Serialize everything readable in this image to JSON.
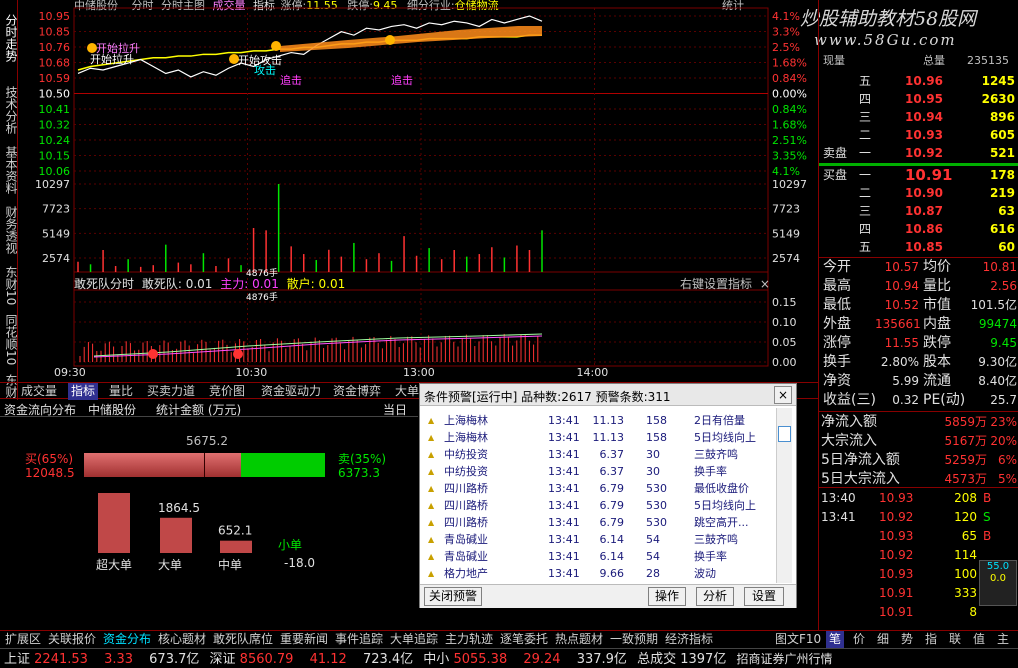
{
  "header": {
    "stock": "中储股份",
    "t1": "分时",
    "t2": "分时主图",
    "t3": "成交量",
    "t4": "指标",
    "zt_label": "涨停:",
    "zt_val": "11.55",
    "dt_label": "跌停:",
    "dt_val": "9.45",
    "industry_label": "细分行业:",
    "industry": "仓储物流",
    "stat": "统计"
  },
  "left_tabs": [
    "分时走势",
    "技术分析",
    "基本资料",
    "财务透视",
    "东财10",
    "同花顺10",
    "东财"
  ],
  "price_axis_left": [
    "10.95",
    "10.85",
    "10.76",
    "10.68",
    "10.59",
    "10.50",
    "10.41",
    "10.32",
    "10.24",
    "10.15",
    "10.06"
  ],
  "pct_axis_right": [
    "4.1%",
    "3.3%",
    "2.5%",
    "1.68%",
    "0.84%",
    "0.00%",
    "0.84%",
    "1.68%",
    "2.51%",
    "3.35%",
    "4.1%"
  ],
  "vol_axis_left": [
    "10297",
    "7723",
    "5149",
    "2574"
  ],
  "vol_axis_right": [
    "10297",
    "7723",
    "5149",
    "2574"
  ],
  "ind_axis_right": [
    "0.15",
    "0.10",
    "0.05",
    "0.00"
  ],
  "time_axis": [
    "09:30",
    "10:30",
    "13:00",
    "14:00"
  ],
  "indicator_line": {
    "name": "敢死队分时",
    "p1": "敢死队: 0.01",
    "p2": "主力: 0.01",
    "p3": "散户: 0.01",
    "right": "右键设置指标",
    "close": "×"
  },
  "signals": {
    "s1": "开始拉升",
    "s2": "开始拉升",
    "s3": "开始攻击",
    "s4": "攻击",
    "s5": "追击",
    "s6": "追击",
    "vol_mark1": "4876手",
    "vol_mark2": "4876手"
  },
  "watermark": {
    "line1": "炒股辅助教材58股网",
    "line2": "www.58Gu.com"
  },
  "chart_data": {
    "type": "line",
    "title": "中储股份 分时",
    "x": [
      "09:30",
      "10:30",
      "13:00",
      "14:00"
    ],
    "ylim": [
      10.06,
      10.95
    ],
    "prev_close": 10.5,
    "series": [
      {
        "name": "价格",
        "values": [
          10.62,
          10.65,
          10.64,
          10.66,
          10.68,
          10.7,
          10.66,
          10.62,
          10.64,
          10.6,
          10.63,
          10.61,
          10.65,
          10.68,
          10.66,
          10.7,
          10.72,
          10.74,
          10.73,
          10.78,
          10.82,
          10.86,
          10.84,
          10.88,
          10.87,
          10.89,
          10.9,
          10.88,
          10.91,
          10.9,
          10.92,
          10.91,
          10.89,
          10.93,
          10.91,
          10.93,
          10.95,
          10.92
        ]
      },
      {
        "name": "均价",
        "values": [
          10.64,
          10.66,
          10.67,
          10.68,
          10.69,
          10.7,
          10.71,
          10.71,
          10.72,
          10.72,
          10.73,
          10.73,
          10.74,
          10.74,
          10.75,
          10.75,
          10.76,
          10.76,
          10.77,
          10.77,
          10.78,
          10.79,
          10.79,
          10.8,
          10.8,
          10.81,
          10.81,
          10.81,
          10.82,
          10.82,
          10.82,
          10.82,
          10.83,
          10.83,
          10.83,
          10.83,
          10.84,
          10.84
        ]
      }
    ],
    "volume": [
      1200,
      900,
      2574,
      700,
      1500,
      600,
      800,
      3200,
      1100,
      900,
      2200,
      700,
      1600,
      800,
      5149,
      4876,
      10297,
      3000,
      2100,
      1400,
      2600,
      1800,
      3400,
      1500,
      2200,
      1300,
      4200,
      1900,
      2800,
      1500,
      2574,
      1800,
      2100,
      2900,
      1700,
      3100,
      2574,
      4876
    ]
  },
  "right_panel": {
    "top_row": {
      "l": "现量",
      "r1": "总量",
      "r2": "235135"
    },
    "sells": [
      {
        "lvl": "五",
        "p": "10.96",
        "v": "1245"
      },
      {
        "lvl": "四",
        "p": "10.95",
        "v": "2630"
      },
      {
        "lvl": "三",
        "p": "10.94",
        "v": "896"
      },
      {
        "lvl": "二",
        "p": "10.93",
        "v": "605"
      },
      {
        "lvl": "一",
        "p": "10.92",
        "v": "521"
      }
    ],
    "sell_label": "卖盘",
    "buy_label": "买盘",
    "buys": [
      {
        "lvl": "一",
        "p": "10.91",
        "v": "178"
      },
      {
        "lvl": "二",
        "p": "10.90",
        "v": "219"
      },
      {
        "lvl": "三",
        "p": "10.87",
        "v": "63"
      },
      {
        "lvl": "四",
        "p": "10.86",
        "v": "616"
      },
      {
        "lvl": "五",
        "p": "10.85",
        "v": "60"
      }
    ],
    "stats": [
      {
        "l": "今开",
        "v": "10.57",
        "l2": "均价",
        "v2": "10.81"
      },
      {
        "l": "最高",
        "v": "10.94",
        "l2": "量比",
        "v2": "2.56"
      },
      {
        "l": "最低",
        "v": "10.52",
        "l2": "市值",
        "v2": "101.5亿"
      },
      {
        "l": "外盘",
        "v": "135661",
        "l2": "内盘",
        "v2": "99474"
      },
      {
        "l": "涨停",
        "v": "11.55",
        "l2": "跌停",
        "v2": "9.45"
      },
      {
        "l": "换手",
        "v": "2.80%",
        "l2": "股本",
        "v2": "9.30亿"
      },
      {
        "l": "净资",
        "v": "5.99",
        "l2": "流通",
        "v2": "8.40亿"
      },
      {
        "l": "收益(三)",
        "v": "0.32",
        "l2": "PE(动)",
        "v2": "25.7"
      }
    ],
    "flows": [
      {
        "l": "净流入额",
        "v": "5859万",
        "p": "23%"
      },
      {
        "l": "大宗流入",
        "v": "5167万",
        "p": "20%"
      },
      {
        "l": "5日净流入额",
        "v": "5259万",
        "p": "6%"
      },
      {
        "l": "5日大宗流入",
        "v": "4573万",
        "p": "5%"
      }
    ],
    "ticks": [
      {
        "t": "13:40",
        "p": "10.93",
        "v": "208",
        "d": "B"
      },
      {
        "t": "13:41",
        "p": "10.92",
        "v": "120",
        "d": "S"
      },
      {
        "t": "",
        "p": "10.93",
        "v": "65",
        "d": "B"
      },
      {
        "t": "",
        "p": "10.92",
        "v": "114",
        "d": ""
      },
      {
        "t": "",
        "p": "10.93",
        "v": "100",
        "d": ""
      },
      {
        "t": "",
        "p": "10.91",
        "v": "333",
        "d": ""
      },
      {
        "t": "",
        "p": "10.91",
        "v": "8",
        "d": ""
      }
    ],
    "mini": {
      "a": "55.0",
      "b": "0.0"
    }
  },
  "sub_tabs": [
    "成交量",
    "指标",
    "量比",
    "买卖力道",
    "竞价图",
    "资金驱动力",
    "资金博弈",
    "大单动向",
    "溯"
  ],
  "fund_panel": {
    "title": "资金流向分布",
    "stock": "中储股份",
    "unit": "统计金额 (万元)",
    "today": "当日",
    "total": "5675.2",
    "buy_label": "买(65%)",
    "buy_val": "12048.5",
    "sell_label": "卖(35%)",
    "sell_val": "6373.3",
    "buy_ratio": 0.65,
    "bars": [
      {
        "name": "超大单",
        "v": "3176.6",
        "num": 3176.6
      },
      {
        "name": "大单",
        "v": "1864.5",
        "num": 1864.5
      },
      {
        "name": "中单",
        "v": "652.1",
        "num": 652.1
      },
      {
        "name": "小单",
        "v": "-18.0",
        "num": -18.0
      }
    ]
  },
  "popup": {
    "title": "条件预警[运行中] 品种数:2617 预警条数:311",
    "close": "×",
    "rows": [
      {
        "n": "上海梅林",
        "t": "13:41",
        "p": "11.13",
        "c": "158",
        "m": "2日有倍量"
      },
      {
        "n": "上海梅林",
        "t": "13:41",
        "p": "11.13",
        "c": "158",
        "m": "5日均线向上"
      },
      {
        "n": "中纺投资",
        "t": "13:41",
        "p": "6.37",
        "c": "30",
        "m": "三鼓齐鸣"
      },
      {
        "n": "中纺投资",
        "t": "13:41",
        "p": "6.37",
        "c": "30",
        "m": "换手率"
      },
      {
        "n": "四川路桥",
        "t": "13:41",
        "p": "6.79",
        "c": "530",
        "m": "最低收盘价"
      },
      {
        "n": "四川路桥",
        "t": "13:41",
        "p": "6.79",
        "c": "530",
        "m": "5日均线向上"
      },
      {
        "n": "四川路桥",
        "t": "13:41",
        "p": "6.79",
        "c": "530",
        "m": "跳空高开..."
      },
      {
        "n": "青岛碱业",
        "t": "13:41",
        "p": "6.14",
        "c": "54",
        "m": "三鼓齐鸣"
      },
      {
        "n": "青岛碱业",
        "t": "13:41",
        "p": "6.14",
        "c": "54",
        "m": "换手率"
      },
      {
        "n": "格力地产",
        "t": "13:41",
        "p": "9.66",
        "c": "28",
        "m": "波动"
      }
    ],
    "btn_close": "关闭预警",
    "btn_op": "操作",
    "btn_an": "分析",
    "btn_set": "设置"
  },
  "bottom_tabs": [
    "扩展区",
    "关联报价",
    "资金分布",
    "核心题材",
    "敢死队席位",
    "重要新闻",
    "事件追踪",
    "大单追踪",
    "主力轨迹",
    "逐笔委托",
    "热点题材",
    "一致预期",
    "经济指标"
  ],
  "bottom_right": [
    "图文F10",
    "笔",
    "价",
    "细",
    "势",
    "指",
    "联",
    "值",
    "主"
  ],
  "status": {
    "sh": "上证",
    "sh_v": "2241.53",
    "sh_c": "3.33",
    "sh_a": "673.7亿",
    "sz": "深证",
    "sz_v": "8560.79",
    "sz_c": "41.12",
    "sz_a": "723.4亿",
    "zx": "中小",
    "zx_v": "5055.38",
    "zx_c": "29.24",
    "zx_a": "337.9亿",
    "tot": "总成交",
    "tot_v": "1397亿",
    "broker": "招商证券广州行情"
  },
  "colors": {
    "up": "#ff3232",
    "down": "#00e600",
    "avg": "#ffff00",
    "price": "#ffffff",
    "grid": "#7a0000",
    "axis_text": "#ff3232"
  }
}
